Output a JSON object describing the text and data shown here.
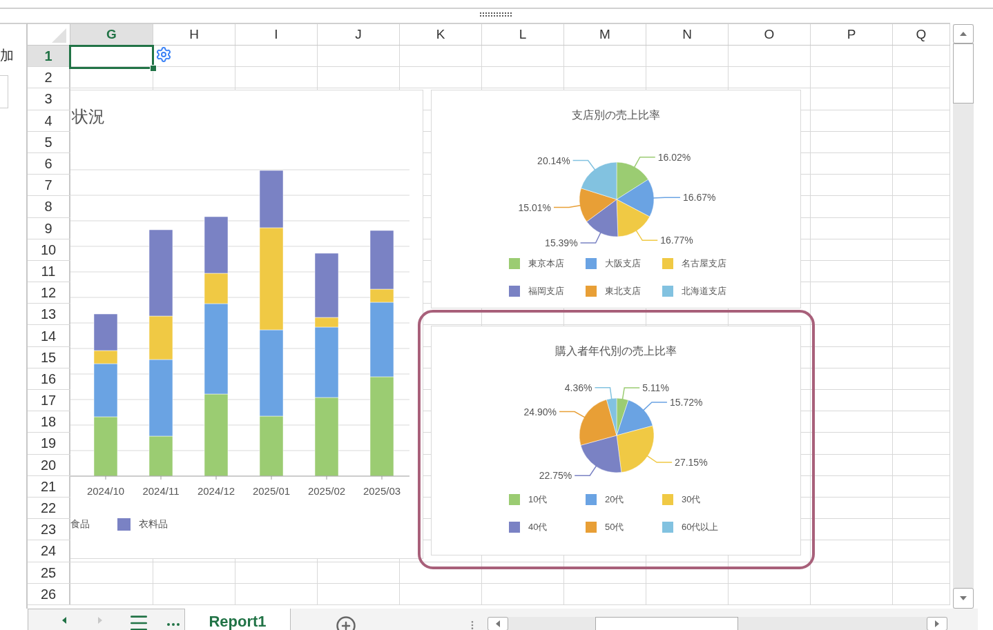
{
  "left_pane": {
    "label": "加"
  },
  "columns": [
    {
      "label": "G",
      "selected": true
    },
    {
      "label": "H",
      "selected": false
    },
    {
      "label": "I",
      "selected": false
    },
    {
      "label": "J",
      "selected": false
    },
    {
      "label": "K",
      "selected": false
    },
    {
      "label": "L",
      "selected": false
    },
    {
      "label": "M",
      "selected": false
    },
    {
      "label": "N",
      "selected": false
    },
    {
      "label": "O",
      "selected": false
    },
    {
      "label": "P",
      "selected": false
    },
    {
      "label": "Q",
      "selected": false
    }
  ],
  "rows": [
    {
      "label": "1",
      "selected": true
    },
    {
      "label": "2",
      "selected": false
    },
    {
      "label": "3",
      "selected": false
    },
    {
      "label": "4",
      "selected": false
    },
    {
      "label": "5",
      "selected": false
    },
    {
      "label": "6",
      "selected": false
    },
    {
      "label": "7",
      "selected": false
    },
    {
      "label": "8",
      "selected": false
    },
    {
      "label": "9",
      "selected": false
    },
    {
      "label": "10",
      "selected": false
    },
    {
      "label": "11",
      "selected": false
    },
    {
      "label": "12",
      "selected": false
    },
    {
      "label": "13",
      "selected": false
    },
    {
      "label": "14",
      "selected": false
    },
    {
      "label": "15",
      "selected": false
    },
    {
      "label": "16",
      "selected": false
    },
    {
      "label": "17",
      "selected": false
    },
    {
      "label": "18",
      "selected": false
    },
    {
      "label": "19",
      "selected": false
    },
    {
      "label": "20",
      "selected": false
    },
    {
      "label": "21",
      "selected": false
    },
    {
      "label": "22",
      "selected": false
    },
    {
      "label": "23",
      "selected": false
    },
    {
      "label": "24",
      "selected": false
    },
    {
      "label": "25",
      "selected": false
    },
    {
      "label": "26",
      "selected": false
    }
  ],
  "bar_chart": {
    "title": "状況",
    "x_labels": [
      "2024/10",
      "2024/11",
      "2024/12",
      "2025/01",
      "2025/02",
      "2025/03"
    ],
    "legend": [
      {
        "label": "食品"
      },
      {
        "label": "衣料品",
        "color": "#7a82c4"
      }
    ]
  },
  "pie_charts": [
    {
      "highlighted": false,
      "chart_data": {
        "type": "pie",
        "title": "支店別の売上比率",
        "categories": [
          "東京本店",
          "大阪支店",
          "名古屋支店",
          "福岡支店",
          "東北支店",
          "北海道支店"
        ],
        "values": [
          16.02,
          16.67,
          16.77,
          15.39,
          15.01,
          20.14
        ],
        "legend": "bottom",
        "value_labels": [
          "16.02%",
          "16.67%",
          "16.77%",
          "15.39%",
          "15.01%",
          "20.14%"
        ]
      }
    },
    {
      "highlighted": true,
      "chart_data": {
        "type": "pie",
        "title": "購入者年代別の売上比率",
        "categories": [
          "10代",
          "20代",
          "30代",
          "40代",
          "50代",
          "60代以上"
        ],
        "values": [
          5.11,
          15.72,
          27.15,
          22.75,
          24.9,
          4.36
        ],
        "legend": "bottom",
        "value_labels": [
          "5.11%",
          "15.72%",
          "27.15%",
          "22.75%",
          "24.90%",
          "4.36%"
        ]
      }
    }
  ],
  "sheet_tabs": [
    {
      "label": "Report1",
      "selected": true
    }
  ]
}
